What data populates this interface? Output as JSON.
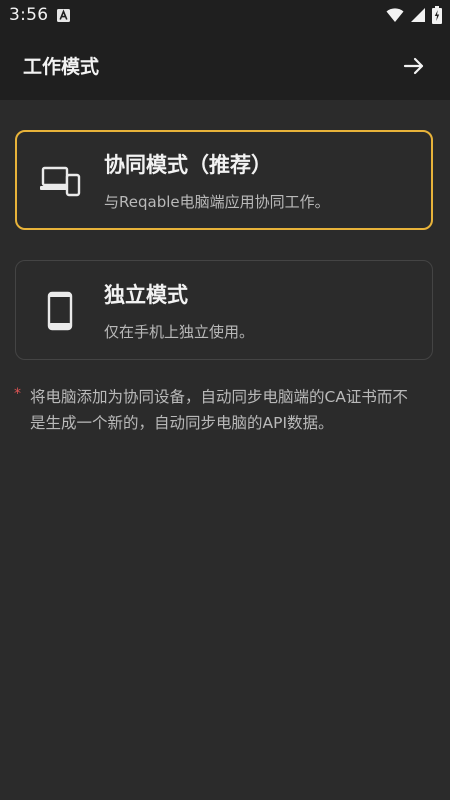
{
  "status_bar": {
    "time": "3:56",
    "icons": [
      "a-notification-icon",
      "wifi-icon",
      "signal-icon",
      "battery-charging-icon"
    ]
  },
  "app_bar": {
    "title": "工作模式",
    "forward_icon": "arrow-right-icon"
  },
  "modes": [
    {
      "title": "协同模式（推荐）",
      "description": "与Reqable电脑端应用协同工作。",
      "icon": "devices-icon",
      "selected": true
    },
    {
      "title": "独立模式",
      "description": "仅在手机上独立使用。",
      "icon": "phone-icon",
      "selected": false
    }
  ],
  "note": {
    "marker": "*",
    "text": "将电脑添加为协同设备，自动同步电脑端的CA证书而不是生成一个新的，自动同步电脑的API数据。"
  },
  "colors": {
    "accent": "#e8b33a",
    "background": "#2b2b2b",
    "bar": "#1f1f1f",
    "required_marker": "#e05555"
  }
}
